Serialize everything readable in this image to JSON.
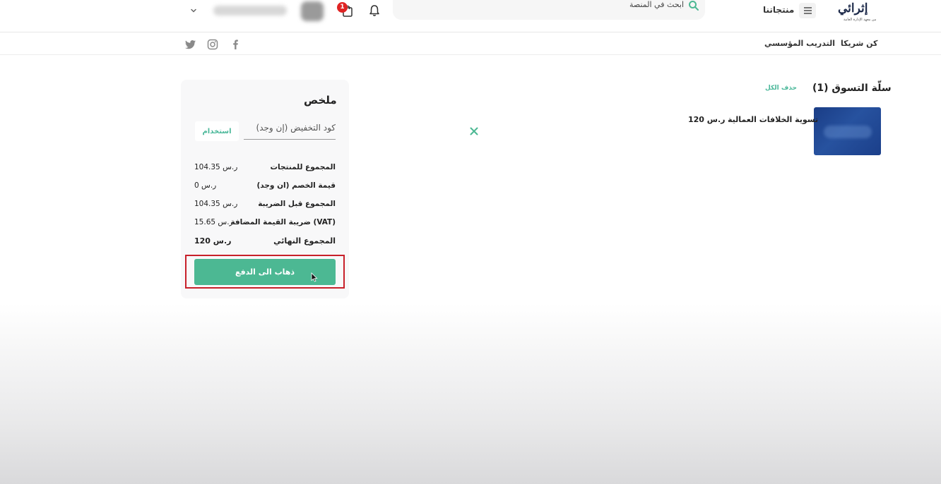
{
  "header": {
    "logo_text": "إثرائي",
    "logo_subtitle": "من معهد الإدارة العامة",
    "products_label": "منتجاتنا",
    "search_placeholder": "ابحث في المنصة",
    "cart_badge_count": "1"
  },
  "subnav": {
    "partner_label": "كن شريكا",
    "training_label": "التدريب المؤسسي"
  },
  "cart": {
    "title": "سلّة التسوق (1)",
    "clear_all_label": "حذف الكل",
    "items": [
      {
        "name": "تسوية الخلافات العمالية",
        "price": "120 ر.س"
      }
    ]
  },
  "summary": {
    "title": "ملخص",
    "discount_placeholder": "كود التخفيض (إن وجد)",
    "apply_label": "استخدام",
    "rows": [
      {
        "label": "المجموع للمنتجات",
        "value": "104.35 ر.س"
      },
      {
        "label": "قيمة الخصم (ان وجد)",
        "value": "0 ر.س"
      },
      {
        "label": "المجموع قبل الضريبة",
        "value": "104.35 ر.س"
      },
      {
        "label": "ضريبة القيمة المضافة (VAT)",
        "value": "15.65 ر.س"
      },
      {
        "label": "المجموع النهائي",
        "value": "120 ر.س"
      }
    ],
    "checkout_label": "ذهاب الى الدفع"
  },
  "colors": {
    "accent_green": "#4cb893",
    "badge_red": "#e02424",
    "highlight_red": "#c8202a",
    "product_image_blue": "#1f4690"
  },
  "icons": [
    "menu-icon",
    "search-icon",
    "bell-icon",
    "cart-icon",
    "chevron-down-icon",
    "facebook-icon",
    "instagram-icon",
    "twitter-icon",
    "close-icon",
    "cursor-icon"
  ]
}
